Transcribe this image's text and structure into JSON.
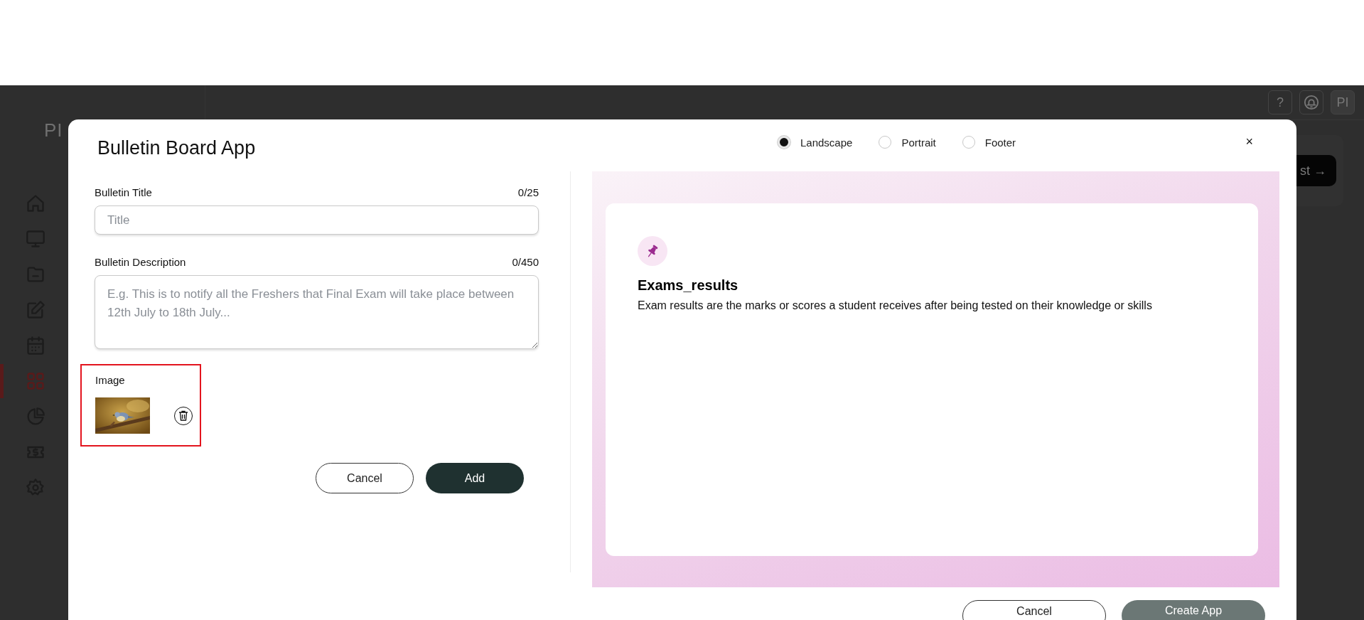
{
  "background": {
    "logo": "PI",
    "action_button": "st →",
    "header_buttons": [
      {
        "kind": "help",
        "label": "?"
      },
      {
        "kind": "bell"
      },
      {
        "kind": "avatar",
        "label": "PI"
      }
    ],
    "sidebar": {
      "items": [
        {
          "selected": false
        },
        {
          "selected": false
        },
        {
          "selected": false
        },
        {
          "selected": false
        },
        {
          "selected": false
        },
        {
          "selected": true
        },
        {
          "selected": false
        },
        {
          "selected": false
        },
        {
          "selected": false
        }
      ]
    }
  },
  "modal": {
    "title": "Bulletin Board App",
    "orientation_options": [
      {
        "label": "Landscape",
        "selected": true
      },
      {
        "label": "Portrait",
        "selected": false
      },
      {
        "label": "Footer",
        "selected": false
      }
    ],
    "close": "×",
    "form": {
      "title_field": {
        "label": "Bulletin Title",
        "counter": "0/25",
        "placeholder": "Title"
      },
      "description_field": {
        "label": "Bulletin Description",
        "counter": "0/450",
        "placeholder": "E.g. This is to notify all the Freshers that Final Exam will take place between 12th July to 18th July..."
      },
      "image": {
        "label": "Image",
        "highlighted": true
      },
      "buttons": [
        {
          "label": "Cancel",
          "kind": "secondary"
        },
        {
          "label": "Add",
          "kind": "primary"
        }
      ]
    },
    "preview": {
      "title": "Exams_results",
      "description": "Exam results are the marks or scores a student receives after being tested on their knowledge or skills"
    },
    "footer_buttons": [
      {
        "label": "Cancel",
        "kind": "secondary"
      },
      {
        "label": "Create App",
        "kind": "primary"
      }
    ]
  }
}
